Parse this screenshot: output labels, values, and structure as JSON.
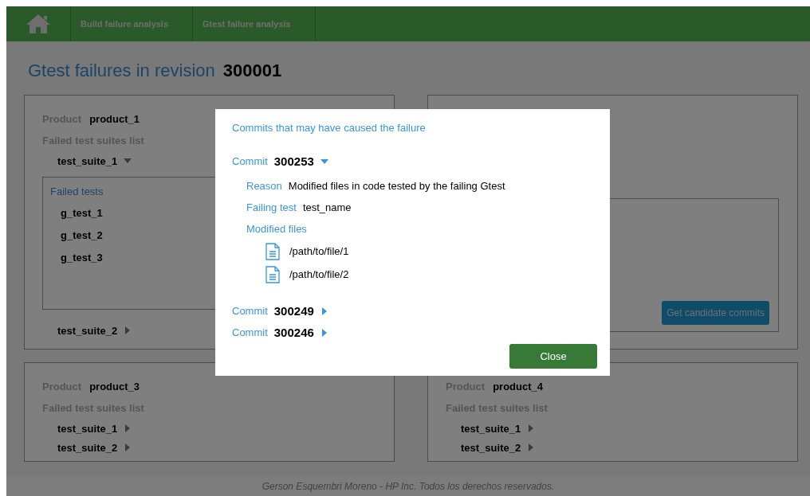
{
  "nav": {
    "items": [
      {
        "label": "Build failure analysis"
      },
      {
        "label": "Gtest failure analysis"
      }
    ]
  },
  "title": {
    "label": "Gtest failures in revision",
    "revision": "300001"
  },
  "products": [
    {
      "kind": "full",
      "product_label": "Product",
      "product": "product_1",
      "suites_label": "Failed test suites list",
      "suites": [
        {
          "name": "test_suite_1",
          "expanded": true,
          "failed_tests_label": "Failed tests",
          "tests": [
            "g_test_1",
            "g_test_2",
            "g_test_3"
          ]
        },
        {
          "name": "test_suite_2",
          "expanded": false
        }
      ]
    },
    {
      "kind": "covered",
      "button": "Get candidate commits"
    },
    {
      "kind": "full",
      "product_label": "Product",
      "product": "product_3",
      "suites_label": "Failed test suites list",
      "suites": [
        {
          "name": "test_suite_1",
          "expanded": false
        },
        {
          "name": "test_suite_2",
          "expanded": false
        }
      ]
    },
    {
      "kind": "full",
      "product_label": "Product",
      "product": "product_4",
      "suites_label": "Failed test suites list",
      "suites": [
        {
          "name": "test_suite_1",
          "expanded": false
        },
        {
          "name": "test_suite_2",
          "expanded": false
        }
      ]
    }
  ],
  "dialog": {
    "heading": "Commits that may have caused the failure",
    "commits": [
      {
        "label": "Commit",
        "id": "300253",
        "expanded": true,
        "reason_label": "Reason",
        "reason": "Modified files in code tested by the failing Gtest",
        "failing_test_label": "Failing test",
        "failing_test": "test_name",
        "files_label": "Modified files",
        "files": [
          "/path/to/file/1",
          "/path/to/file/2"
        ]
      },
      {
        "label": "Commit",
        "id": "300249",
        "expanded": false
      },
      {
        "label": "Commit",
        "id": "300246",
        "expanded": false
      }
    ],
    "close": "Close"
  },
  "footer": "Gerson Esquembri Moreno - HP Inc. Todos los derechos reservados."
}
